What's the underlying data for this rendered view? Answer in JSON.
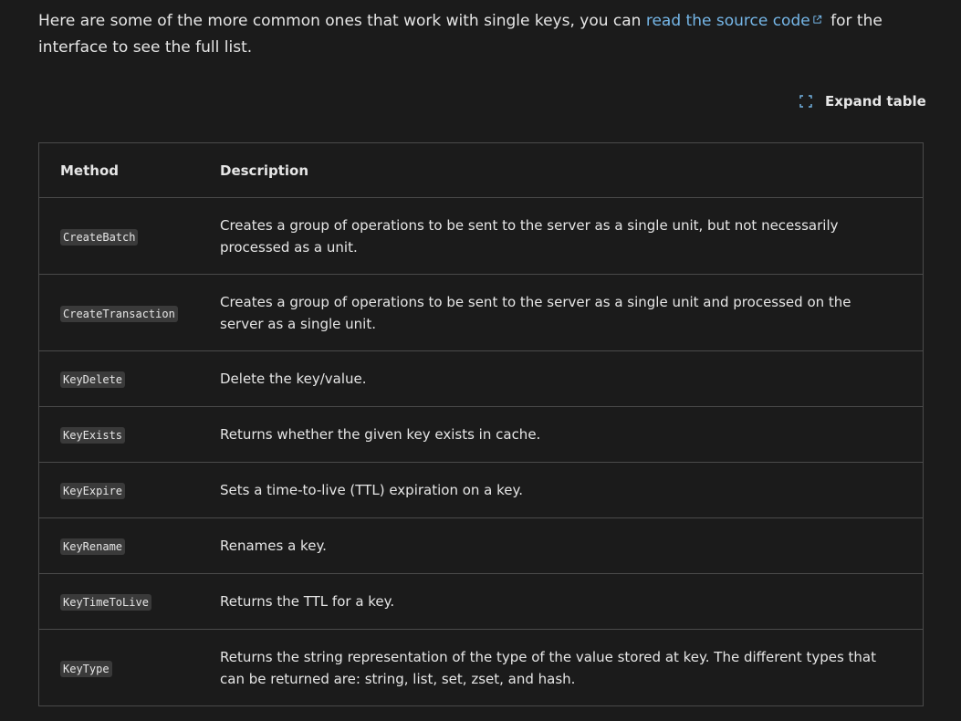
{
  "intro": {
    "text_before": "Here are some of the more common ones that work with single keys, you can ",
    "link_text": "read the source code",
    "text_after": " for the interface to see the full list."
  },
  "expand_button": {
    "label": "Expand table",
    "icon": "expand-icon"
  },
  "colors": {
    "background": "#1b1b1b",
    "link": "#75b6e7",
    "border": "#4a4a4a",
    "code_bg": "#3a3a3a"
  },
  "table": {
    "headers": [
      "Method",
      "Description"
    ],
    "rows": [
      {
        "method": "CreateBatch",
        "description": "Creates a group of operations to be sent to the server as a single unit, but not necessarily processed as a unit."
      },
      {
        "method": "CreateTransaction",
        "description": "Creates a group of operations to be sent to the server as a single unit and processed on the server as a single unit."
      },
      {
        "method": "KeyDelete",
        "description": "Delete the key/value."
      },
      {
        "method": "KeyExists",
        "description": "Returns whether the given key exists in cache."
      },
      {
        "method": "KeyExpire",
        "description": "Sets a time-to-live (TTL) expiration on a key."
      },
      {
        "method": "KeyRename",
        "description": "Renames a key."
      },
      {
        "method": "KeyTimeToLive",
        "description": "Returns the TTL for a key."
      },
      {
        "method": "KeyType",
        "description": "Returns the string representation of the type of the value stored at key. The different types that can be returned are: string, list, set, zset, and hash."
      }
    ]
  }
}
